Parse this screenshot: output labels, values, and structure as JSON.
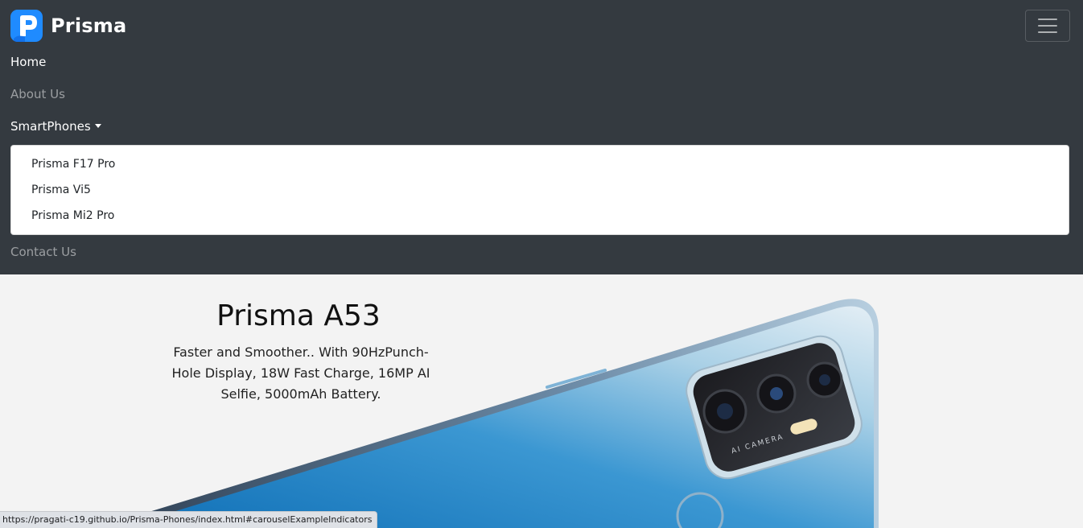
{
  "brand": {
    "name": "Prisma",
    "logo_icon": "prisma-p-logo-icon",
    "accent": "#1f8bff"
  },
  "navbar": {
    "background": "#343a40",
    "toggler_icon": "hamburger-menu-icon",
    "items": {
      "home": "Home",
      "about": "About Us",
      "smartphones": "SmartPhones",
      "contact": "Contact Us"
    },
    "dropdown": {
      "items": [
        "Prisma F17 Pro",
        "Prisma Vi5",
        "Prisma Mi2 Pro"
      ]
    }
  },
  "hero": {
    "title": "Prisma A53",
    "description": "Faster and Smoother.. With 90HzPunch-Hole Display, 18W Fast Charge, 16MP AI Selfie, 5000mAh Battery.",
    "camera_label": "AI CAMERA"
  },
  "status_bar": {
    "url": "https://pragati-c19.github.io/Prisma-Phones/index.html#carouselExampleIndicators"
  }
}
